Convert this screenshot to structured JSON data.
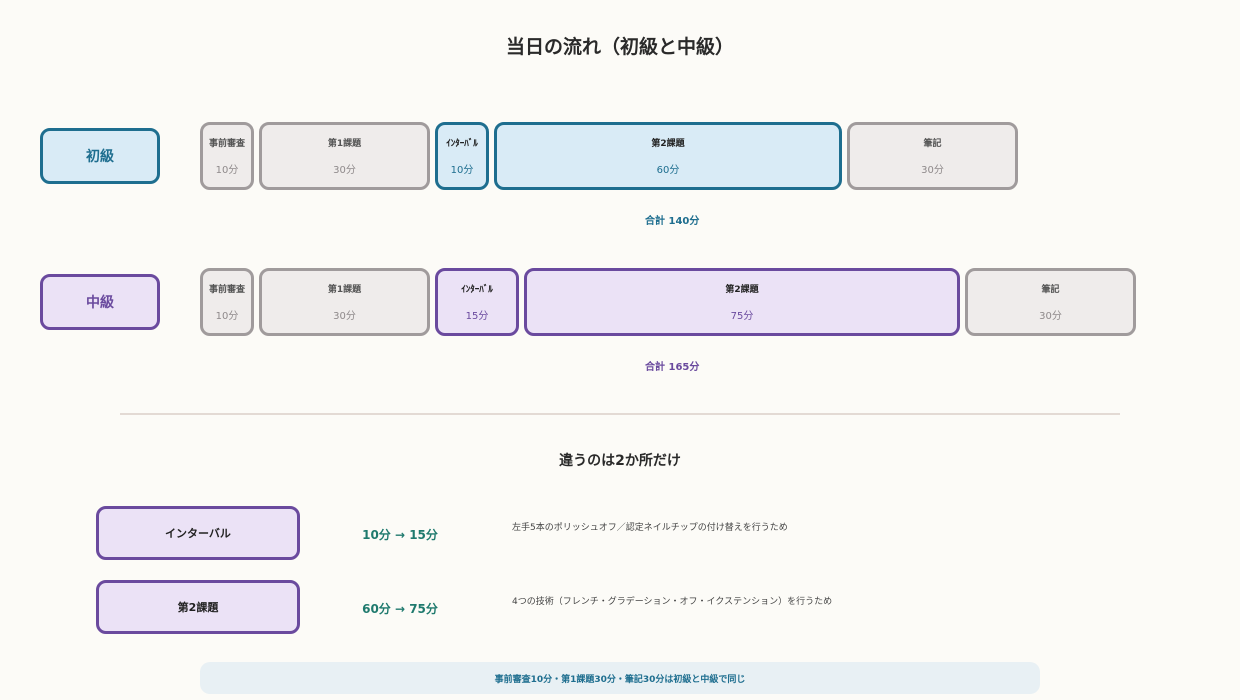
{
  "title": "当日の流れ（初級と中級）",
  "levels": {
    "beginner": {
      "label": "初級",
      "blocks": [
        {
          "name": "事前審査",
          "duration": "10分",
          "minutes": 10
        },
        {
          "name": "第1課題",
          "duration": "30分",
          "minutes": 30
        },
        {
          "name": "ｲﾝﾀｰﾊﾞﾙ",
          "duration": "10分",
          "minutes": 10
        },
        {
          "name": "第2課題",
          "duration": "60分",
          "minutes": 60
        },
        {
          "name": "筆記",
          "duration": "30分",
          "minutes": 30
        }
      ],
      "total": "合計 140分"
    },
    "intermediate": {
      "label": "中級",
      "blocks": [
        {
          "name": "事前審査",
          "duration": "10分",
          "minutes": 10
        },
        {
          "name": "第1課題",
          "duration": "30分",
          "minutes": 30
        },
        {
          "name": "ｲﾝﾀｰﾊﾞﾙ",
          "duration": "15分",
          "minutes": 15
        },
        {
          "name": "第2課題",
          "duration": "75分",
          "minutes": 75
        },
        {
          "name": "筆記",
          "duration": "30分",
          "minutes": 30
        }
      ],
      "total": "合計 165分"
    }
  },
  "differences": {
    "heading": "違うのは2か所だけ",
    "items": [
      {
        "label": "インターバル",
        "change": "10分 → 15分",
        "reason": "左手5本のポリッシュオフ／認定ネイルチップの付け替えを行うため"
      },
      {
        "label": "第2課題",
        "change": "60分 → 75分",
        "reason": "4つの技術（フレンチ・グラデーション・オフ・イクステンション）を行うため"
      }
    ]
  },
  "note": "事前審査10分・第1課題30分・筆記30分は初級と中級で同じ",
  "colors": {
    "beginner_accent": "#1e6e8f",
    "intermediate_accent": "#6a4a9e",
    "shared_block": "#a09b9c",
    "change_text": "#1f7a6e"
  }
}
